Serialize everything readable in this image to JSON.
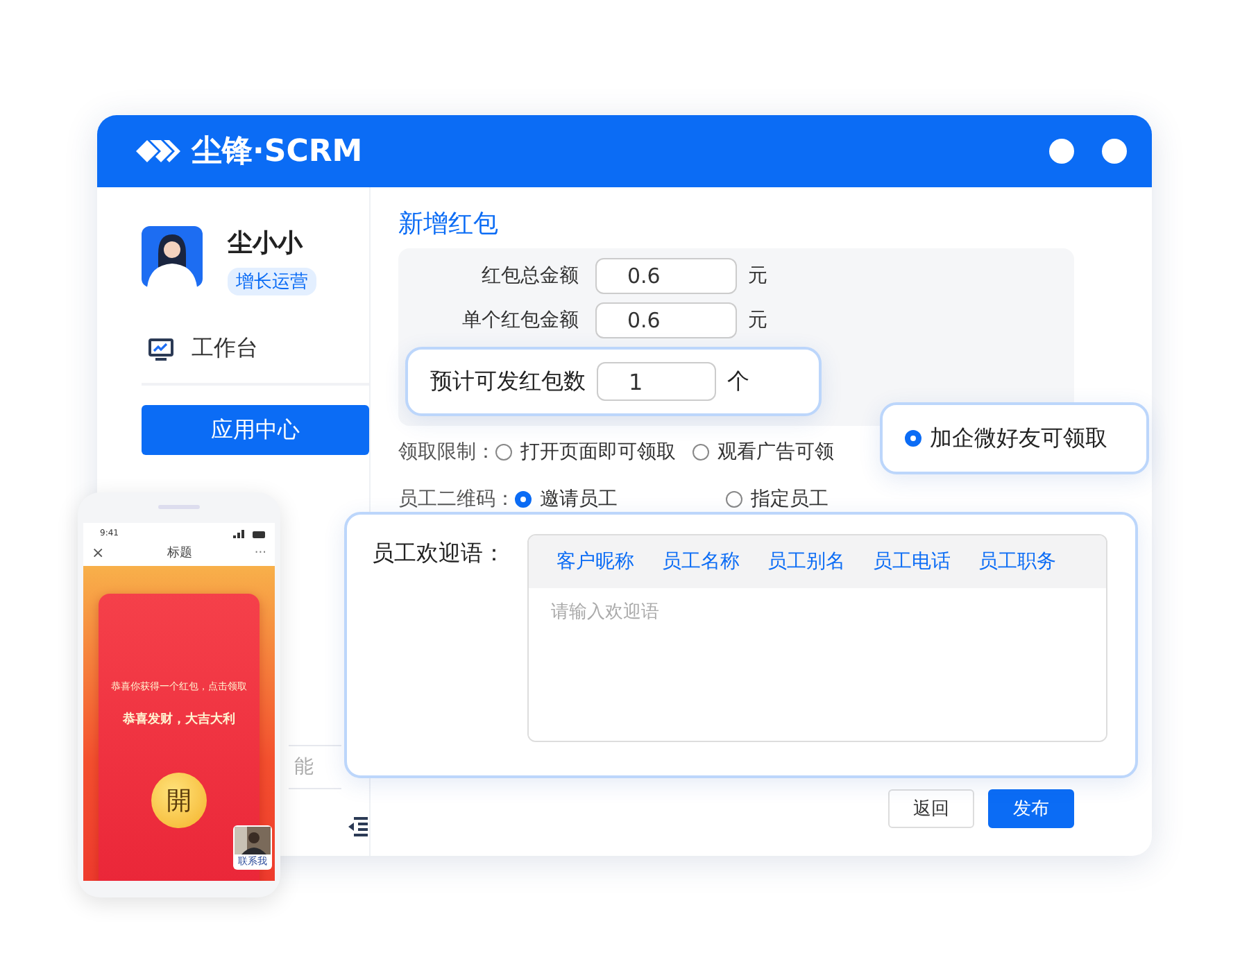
{
  "brand": {
    "name": "尘锋·SCRM"
  },
  "user": {
    "name": "尘小小",
    "role": "增长运营"
  },
  "sidebar": {
    "nav_item": "工作台",
    "app_center_button": "应用中心",
    "partial_item": "能"
  },
  "page_title": "新增红包",
  "amount_fields": [
    {
      "label": "红包总金额",
      "value": "0.6",
      "unit": "元"
    },
    {
      "label": "单个红包金额",
      "value": "0.6",
      "unit": "元"
    }
  ],
  "estimate": {
    "label": "预计可发红包数",
    "value": "1",
    "unit": "个"
  },
  "claim_limit": {
    "label": "领取限制：",
    "options": [
      {
        "label": "打开页面即可领取",
        "selected": false
      },
      {
        "label": "观看广告可领",
        "selected": false
      },
      {
        "label": "加企微好友可领取",
        "selected": true
      }
    ]
  },
  "qr_code": {
    "label": "员工二维码：",
    "options": [
      {
        "label": "邀请员工",
        "selected": true
      },
      {
        "label": "指定员工",
        "selected": false
      }
    ]
  },
  "welcome": {
    "label": "员工欢迎语：",
    "variables": [
      "客户昵称",
      "员工名称",
      "员工别名",
      "员工电话",
      "员工职务"
    ],
    "placeholder": "请输入欢迎语"
  },
  "buttons": [
    {
      "label": "返回",
      "kind": "secondary"
    },
    {
      "label": "发布",
      "kind": "primary"
    }
  ],
  "phone": {
    "time": "9:41",
    "close": "×",
    "title": "标题",
    "more": "···",
    "envelope_line_1": "恭喜你获得一个红包，点击领取",
    "envelope_line_2": "恭喜发财，大吉大利",
    "open_button": "開",
    "contact": "联系我"
  }
}
